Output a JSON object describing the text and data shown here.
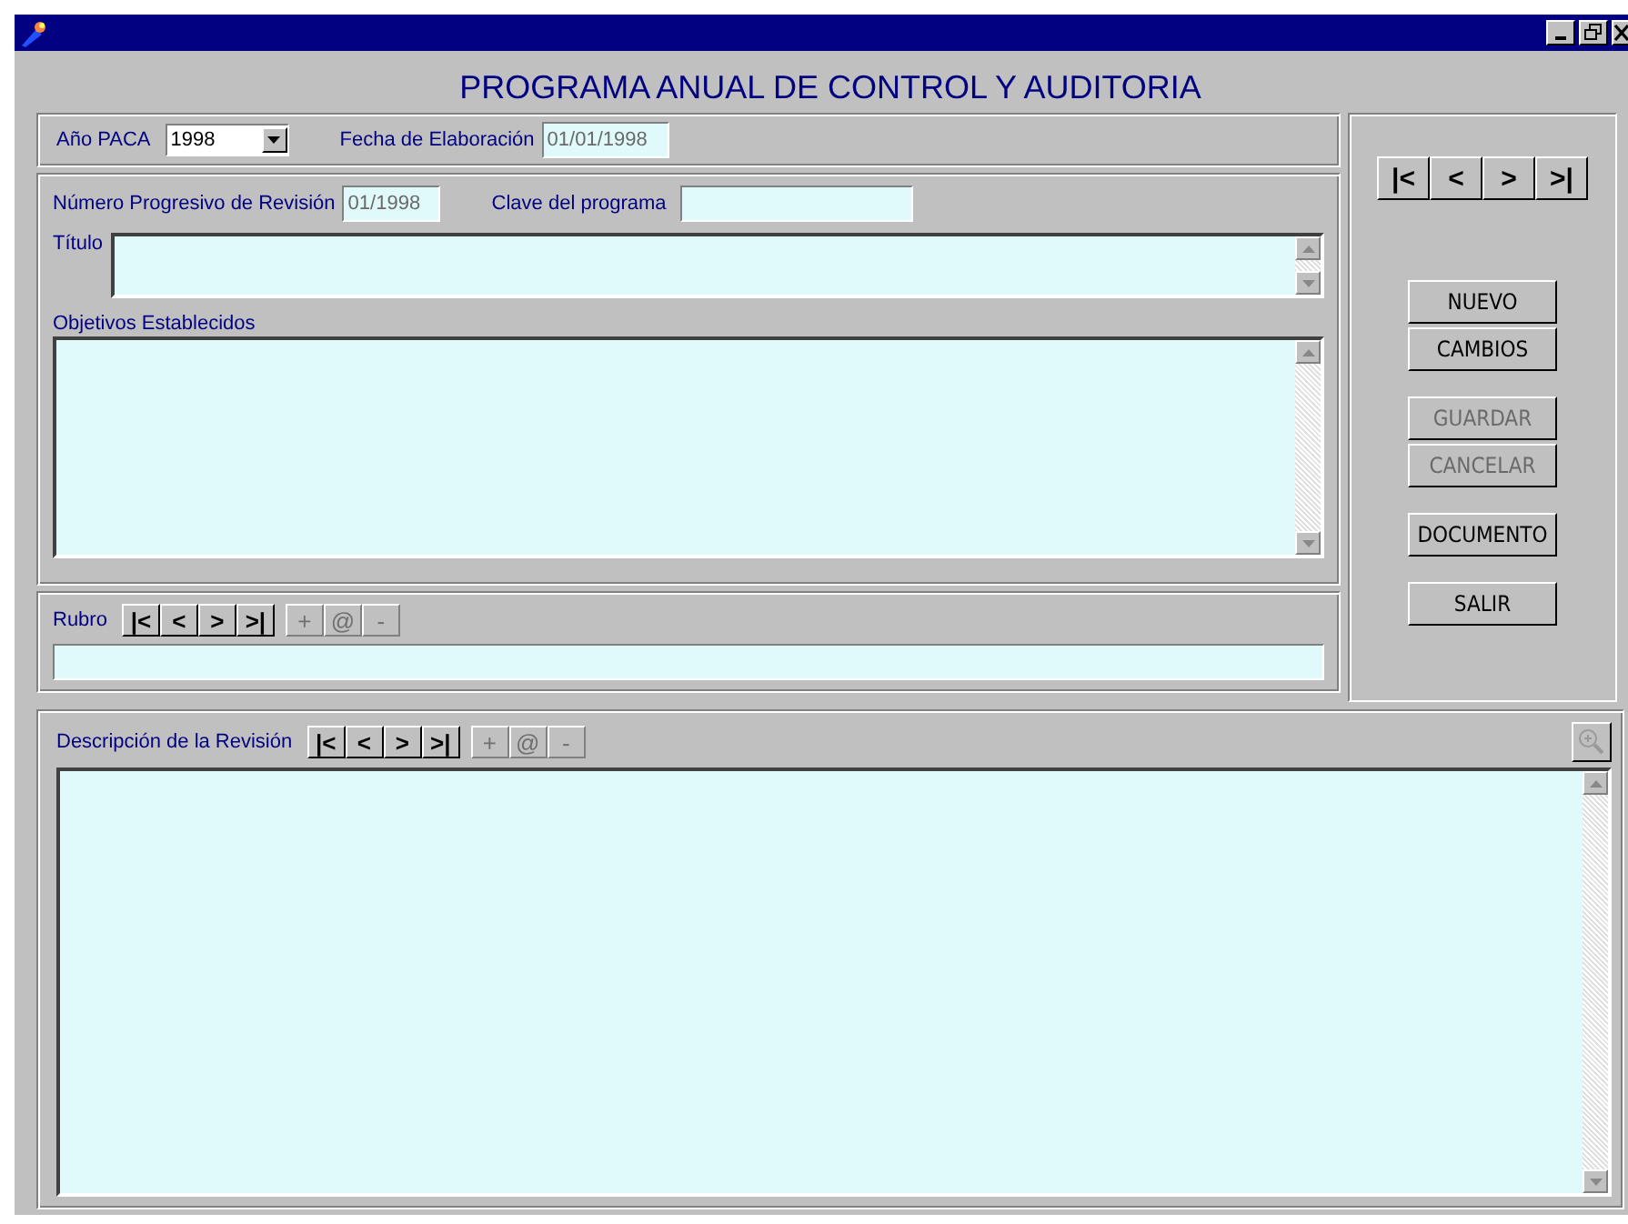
{
  "heading": "PROGRAMA ANUAL DE CONTROL Y AUDITORIA",
  "year": {
    "label": "Año PACA",
    "value": "1998"
  },
  "fecha": {
    "label": "Fecha de Elaboración",
    "value": "01/01/1998",
    "disabled": true
  },
  "numero": {
    "label": "Número Progresivo de Revisión",
    "value": "01/1998",
    "disabled": true
  },
  "clave": {
    "label": "Clave del programa"
  },
  "titulo": {
    "label": "Título"
  },
  "objetivos": {
    "label": "Objetivos Establecidos"
  },
  "record_nav": [
    "|<",
    "<",
    ">",
    ">|"
  ],
  "actions": [
    {
      "label": "NUEVO",
      "disabled": false
    },
    {
      "label": "CAMBIOS",
      "disabled": false
    },
    {
      "label": "GUARDAR",
      "disabled": true
    },
    {
      "label": "CANCELAR",
      "disabled": true
    },
    {
      "label": "DOCUMENTO",
      "disabled": false
    },
    {
      "label": "SALIR",
      "disabled": false
    }
  ],
  "rubro": {
    "label": "Rubro",
    "nav": [
      "|<",
      "<",
      ">",
      ">|"
    ],
    "edit": [
      {
        "label": "+",
        "disabled": true
      },
      {
        "label": "@",
        "disabled": true
      },
      {
        "label": "-",
        "disabled": true
      }
    ]
  },
  "descripcion": {
    "label": "Descripción de la Revisión",
    "nav": [
      "|<",
      "<",
      ">",
      ">|"
    ],
    "edit": [
      {
        "label": "+",
        "disabled": true
      },
      {
        "label": "@",
        "disabled": true
      },
      {
        "label": "-",
        "disabled": true
      }
    ]
  }
}
